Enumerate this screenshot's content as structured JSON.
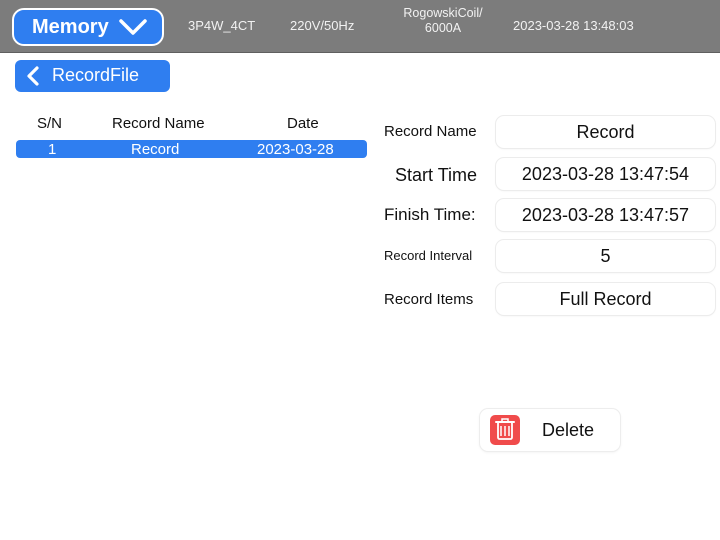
{
  "topbar": {
    "mode_label": "Memory",
    "wiring": "3P4W_4CT",
    "voltage": "220V/50Hz",
    "sensor_line1": "RogowskiCoil/",
    "sensor_line2": "6000A",
    "datetime": "2023-03-28 13:48:03"
  },
  "nav": {
    "back_label": "RecordFile"
  },
  "record_list": {
    "headers": [
      "S/N",
      "Record Name",
      "Date"
    ],
    "rows": [
      {
        "sn": "1",
        "name": "Record",
        "date": "2023-03-28",
        "selected": true
      }
    ]
  },
  "details": {
    "fields": [
      {
        "label": "Record Name",
        "value": "Record"
      },
      {
        "label": "Start Time",
        "value": "2023-03-28 13:47:54"
      },
      {
        "label": "Finish Time:",
        "value": "2023-03-28 13:47:57"
      },
      {
        "label": "Record Interval",
        "value": "5"
      },
      {
        "label": "Record Items",
        "value": "Full Record"
      }
    ]
  },
  "actions": {
    "delete_label": "Delete"
  },
  "icons": {
    "mode_dropdown": "chevron-down-icon",
    "back": "chevron-left-icon",
    "delete": "trash-icon"
  },
  "colors": {
    "accent": "#2f7ef0",
    "topbar_bg": "#7c7c7c",
    "delete_icon_bg": "#f04b4b",
    "background": "#ffffff"
  }
}
